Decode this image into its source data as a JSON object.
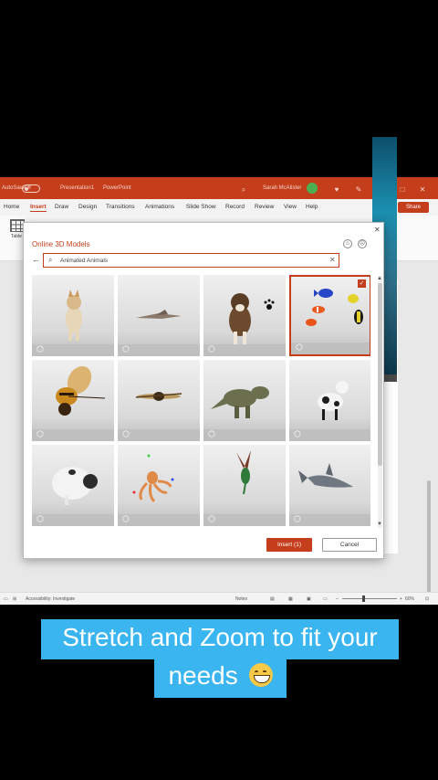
{
  "titlebar": {
    "autosave_label": "AutoSave",
    "toggle_state": "Off",
    "file_name": "Presentation1",
    "app_name": "PowerPoint",
    "user_name": "Sarah McAlister"
  },
  "ribbon": {
    "tabs": [
      "Home",
      "Insert",
      "Draw",
      "Design",
      "Transitions",
      "Animations",
      "Slide Show",
      "Record",
      "Review",
      "View",
      "Help"
    ],
    "active_tab": "Insert",
    "share_label": "Share",
    "table_label": "Table"
  },
  "statusbar": {
    "accessibility": "Accessibility: Investigate",
    "notes": "Notes",
    "zoom": "60%"
  },
  "dialog": {
    "title": "Online 3D Models",
    "search": {
      "value": "Animated Animals"
    },
    "models": [
      {
        "name": "dog-shiba",
        "selected": false
      },
      {
        "name": "pterodactyl",
        "selected": false
      },
      {
        "name": "boxer-dog",
        "selected": false
      },
      {
        "name": "tropical-fish",
        "selected": true
      },
      {
        "name": "bee",
        "selected": false
      },
      {
        "name": "dragonfly",
        "selected": false
      },
      {
        "name": "t-rex",
        "selected": false
      },
      {
        "name": "cow",
        "selected": false
      },
      {
        "name": "pug",
        "selected": false
      },
      {
        "name": "octopus",
        "selected": false
      },
      {
        "name": "hummingbird",
        "selected": false
      },
      {
        "name": "shark",
        "selected": false
      }
    ],
    "insert_label": "Insert (1)",
    "cancel_label": "Cancel"
  },
  "caption": {
    "line1": "Stretch and Zoom to fit your",
    "line2": "needs"
  },
  "colors": {
    "accent": "#c43e1c",
    "caption_bg": "#3bb5f0"
  }
}
